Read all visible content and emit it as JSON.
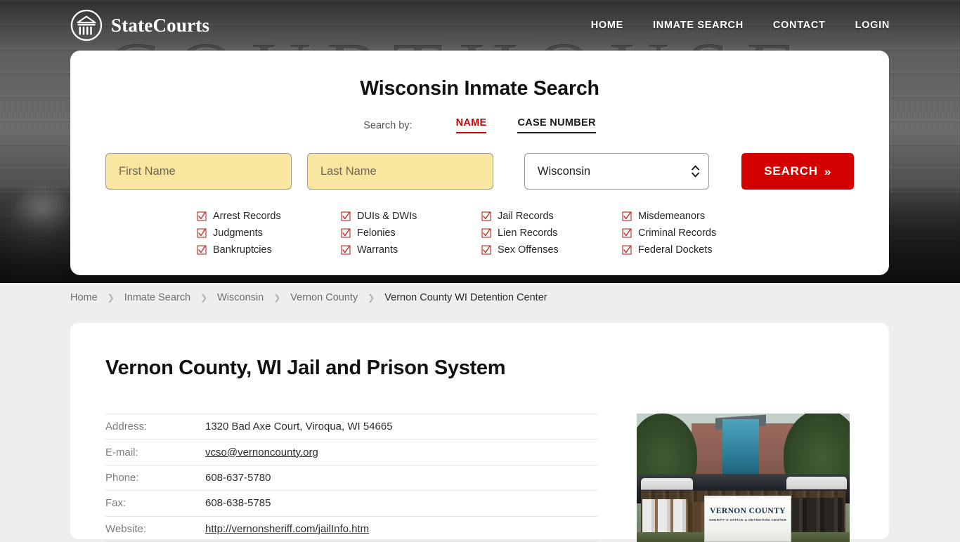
{
  "brand": {
    "name": "StateCourts",
    "logo_icon": "courthouse-circle-logo"
  },
  "nav": [
    {
      "label": "HOME"
    },
    {
      "label": "INMATE SEARCH"
    },
    {
      "label": "CONTACT"
    },
    {
      "label": "LOGIN"
    }
  ],
  "search_card": {
    "title": "Wisconsin Inmate Search",
    "search_by_label": "Search by:",
    "tabs": [
      {
        "label": "NAME",
        "active": true
      },
      {
        "label": "CASE NUMBER",
        "active": false
      }
    ],
    "first_name_placeholder": "First Name",
    "first_name_value": "",
    "last_name_placeholder": "Last Name",
    "last_name_value": "",
    "state_value": "Wisconsin",
    "state_options": [
      "Wisconsin"
    ],
    "search_button": "SEARCH",
    "search_button_chevron": "»",
    "checkbox_icon": "checked-checkbox-icon",
    "checkboxes": [
      "Arrest Records",
      "DUIs & DWIs",
      "Jail Records",
      "Misdemeanors",
      "Judgments",
      "Felonies",
      "Lien Records",
      "Criminal Records",
      "Bankruptcies",
      "Warrants",
      "Sex Offenses",
      "Federal Dockets"
    ]
  },
  "breadcrumb": {
    "separator_icon": "chevron-right-icon",
    "items": [
      {
        "label": "Home",
        "current": false
      },
      {
        "label": "Inmate Search",
        "current": false
      },
      {
        "label": "Wisconsin",
        "current": false
      },
      {
        "label": "Vernon County",
        "current": false
      },
      {
        "label": "Vernon County WI Detention Center",
        "current": true
      }
    ]
  },
  "content": {
    "page_title": "Vernon County, WI Jail and Prison System",
    "details": [
      {
        "label": "Address:",
        "value": "1320 Bad Axe Court, Viroqua, WI 54665",
        "link": false
      },
      {
        "label": "E-mail:",
        "value": "vcso@vernoncounty.org",
        "link": true
      },
      {
        "label": "Phone:",
        "value": "608-637-5780",
        "link": false
      },
      {
        "label": "Fax:",
        "value": "608-638-5785",
        "link": false
      },
      {
        "label": "Website:",
        "value": "http://vernonsheriff.com/jailInfo.htm",
        "link": true
      }
    ],
    "photo": {
      "name": "vernon-county-sheriff-office-photo",
      "sign_line1": "VERNON COUNTY",
      "sign_line2": "SHERIFF'S OFFICE & DETENTION CENTER"
    }
  },
  "colors": {
    "accent_red": "#d40000",
    "tab_active_red": "#cc0000",
    "input_yellow": "#f9e79f",
    "page_bg": "#eeeeee",
    "card_bg": "#ffffff"
  }
}
